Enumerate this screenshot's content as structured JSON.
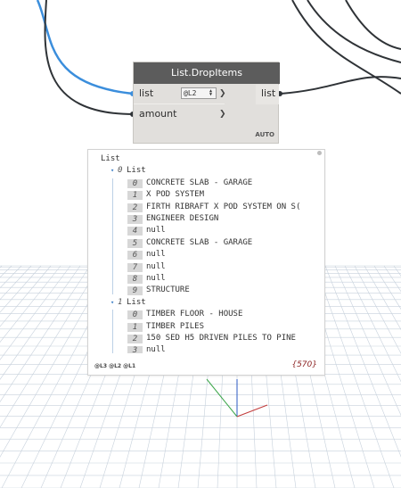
{
  "node": {
    "title": "List.DropItems",
    "inputs": [
      {
        "label": "list",
        "lacing": "@L2"
      },
      {
        "label": "amount"
      }
    ],
    "output": "list",
    "lacing_mode": "AUTO"
  },
  "preview": {
    "root": "List",
    "groups": [
      {
        "index": "0",
        "label": "List",
        "items": [
          {
            "index": "0",
            "value": "CONCRETE SLAB - GARAGE"
          },
          {
            "index": "1",
            "value": "X POD SYSTEM"
          },
          {
            "index": "2",
            "value": "FIRTH RIBRAFT X POD SYSTEM ON S("
          },
          {
            "index": "3",
            "value": "ENGINEER DESIGN"
          },
          {
            "index": "4",
            "value": "null"
          },
          {
            "index": "5",
            "value": "CONCRETE SLAB - GARAGE"
          },
          {
            "index": "6",
            "value": "null"
          },
          {
            "index": "7",
            "value": "null"
          },
          {
            "index": "8",
            "value": "null"
          },
          {
            "index": "9",
            "value": "STRUCTURE"
          }
        ]
      },
      {
        "index": "1",
        "label": "List",
        "items": [
          {
            "index": "0",
            "value": "TIMBER FLOOR - HOUSE"
          },
          {
            "index": "1",
            "value": "TIMBER PILES"
          },
          {
            "index": "2",
            "value": "150 SED H5 DRIVEN PILES TO PINE"
          },
          {
            "index": "3",
            "value": "null"
          }
        ]
      }
    ],
    "levels": "@L3 @L2 @L1",
    "count": "{570}"
  },
  "colors": {
    "active_wire": "#3b8edc",
    "wire": "#2f3337",
    "grid": "#c7d1dc",
    "axis_green": "#3ca64a",
    "axis_blue": "#2b59c3",
    "axis_red": "#c23b3b",
    "node_header": "#5c5c5c"
  }
}
